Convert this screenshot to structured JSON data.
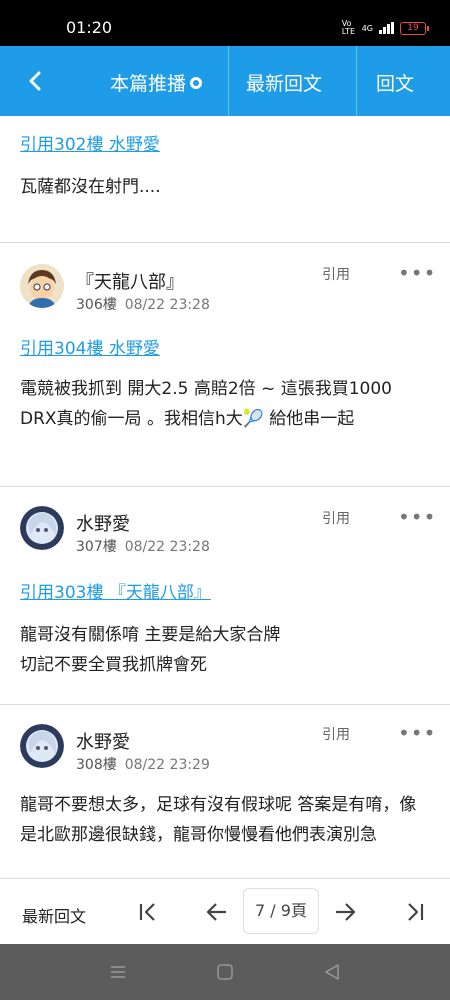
{
  "status": {
    "time": "01:20",
    "volte": "Vo LTE",
    "network": "4G",
    "battery": "19"
  },
  "appbar": {
    "tabs": [
      "本篇推播",
      "最新回文",
      "回文"
    ]
  },
  "posts": [
    {
      "quote": "引用302樓 水野愛",
      "body": "瓦薩都沒在射門...."
    },
    {
      "username": "『天龍八部』",
      "floor": "306樓",
      "date": "08/22 23:28",
      "quote_btn": "引用",
      "quote": "引用304樓 水野愛",
      "body": "電競被我抓到 開大2.5 高賠2倍 ~ 這張我買1000 DRX真的偷一局 。我相信h大🎾 給他串一起"
    },
    {
      "username": "水野愛",
      "floor": "307樓",
      "date": "08/22 23:28",
      "quote_btn": "引用",
      "quote": "引用303樓 『天龍八部』",
      "body_lines": [
        "龍哥沒有關係唷 主要是給大家合牌",
        "切記不要全買我抓牌會死"
      ]
    },
    {
      "username": "水野愛",
      "floor": "308樓",
      "date": "08/22 23:29",
      "quote_btn": "引用",
      "body": "龍哥不要想太多，足球有沒有假球呢 答案是有唷，像是北歐那邊很缺錢，龍哥你慢慢看他們表演別急"
    }
  ],
  "more_label": "•••",
  "pager": {
    "latest_label": "最新回文",
    "page_indicator": "7 / 9頁"
  },
  "colors": {
    "accent": "#1e9ce8",
    "navbar": "#5c5c5c"
  }
}
